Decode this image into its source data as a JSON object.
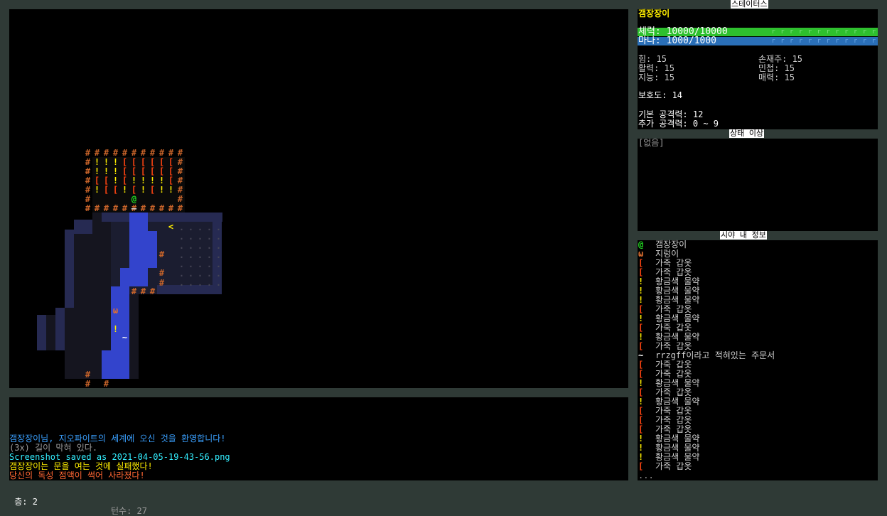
{
  "panels": {
    "status": "스테이터스",
    "affliction": "상태 이상",
    "sight": "시야 내 정보"
  },
  "status": {
    "name": "갬장장이",
    "hp": "체력: 10000/10000",
    "mp": "마나: 1000/1000",
    "bar_fill": "r r r r r r r r r r r r",
    "str": "힘: 15",
    "dex": "손재주: 15",
    "con": "활력: 15",
    "agi": "민첩: 15",
    "int": "지능: 15",
    "cha": "매력: 15",
    "armor": "보호도: 14",
    "base_atk": "기본 공격력: 12",
    "bonus_atk": "추가 공격력: 0 ~ 9"
  },
  "affliction": {
    "none": "[없음]"
  },
  "sight_rows": [
    {
      "glyph": "@",
      "color": "#22dd22",
      "label": "갬장장이"
    },
    {
      "glyph": "ω",
      "color": "#e07030",
      "label": "지렁이"
    },
    {
      "glyph": "[",
      "color": "#ff4411",
      "label": "가죽 갑옷"
    },
    {
      "glyph": "[",
      "color": "#ff4411",
      "label": "가죽 갑옷"
    },
    {
      "glyph": "!",
      "color": "#ffee00",
      "label": "황금색 물약"
    },
    {
      "glyph": "!",
      "color": "#ffee00",
      "label": "황금색 물약"
    },
    {
      "glyph": "!",
      "color": "#ffee00",
      "label": "황금색 물약"
    },
    {
      "glyph": "[",
      "color": "#ff4411",
      "label": "가죽 갑옷"
    },
    {
      "glyph": "!",
      "color": "#ffee00",
      "label": "황금색 물약"
    },
    {
      "glyph": "[",
      "color": "#ff4411",
      "label": "가죽 갑옷"
    },
    {
      "glyph": "!",
      "color": "#ffee00",
      "label": "황금색 물약"
    },
    {
      "glyph": "[",
      "color": "#ff4411",
      "label": "가죽 갑옷"
    },
    {
      "glyph": "~",
      "color": "#ffffff",
      "label": "rrzgff이라고 적혀있는 주문서"
    },
    {
      "glyph": "[",
      "color": "#ff4411",
      "label": "가죽 갑옷"
    },
    {
      "glyph": "[",
      "color": "#ff4411",
      "label": "가죽 갑옷"
    },
    {
      "glyph": "!",
      "color": "#ffee00",
      "label": "황금색 물약"
    },
    {
      "glyph": "[",
      "color": "#ff4411",
      "label": "가죽 갑옷"
    },
    {
      "glyph": "!",
      "color": "#ffee00",
      "label": "황금색 물약"
    },
    {
      "glyph": "[",
      "color": "#ff4411",
      "label": "가죽 갑옷"
    },
    {
      "glyph": "[",
      "color": "#ff4411",
      "label": "가죽 갑옷"
    },
    {
      "glyph": "[",
      "color": "#ff4411",
      "label": "가죽 갑옷"
    },
    {
      "glyph": "!",
      "color": "#ffee00",
      "label": "황금색 물약"
    },
    {
      "glyph": "!",
      "color": "#ffee00",
      "label": "황금색 물약"
    },
    {
      "glyph": "!",
      "color": "#ffee00",
      "label": "황금색 물약"
    },
    {
      "glyph": "[",
      "color": "#ff4411",
      "label": "가죽 갑옷"
    }
  ],
  "sight_more": "...",
  "messages": [
    {
      "text": "갬장장이님, 지오파이트의 세계에 오신 것을 환영합니다!",
      "color": "#3aa0ff"
    },
    {
      "text": "(3x) 길이 막혀 있다.",
      "color": "#9a9a9a"
    },
    {
      "text": "Screenshot saved as 2021-04-05-19-43-56.png",
      "color": "#33eeff"
    },
    {
      "text": "갬장장이는 문을 여는 것에 실패했다!",
      "color": "#ffee00"
    },
    {
      "text": "당신의 독성 점액이 썩어 사라졌다!",
      "color": "#ff6633"
    }
  ],
  "footer": {
    "floor": "층: 2",
    "turns": "턴수: 27"
  },
  "colors": {
    "wall": "#c8642a",
    "water": "#3344cc",
    "player": "#22dd22",
    "potion": "#ffee00",
    "armor": "#ff4411",
    "stairs": "#ffee00",
    "worm": "#e07030",
    "hp": "#2ec02e",
    "mp": "#2a7fd0"
  }
}
